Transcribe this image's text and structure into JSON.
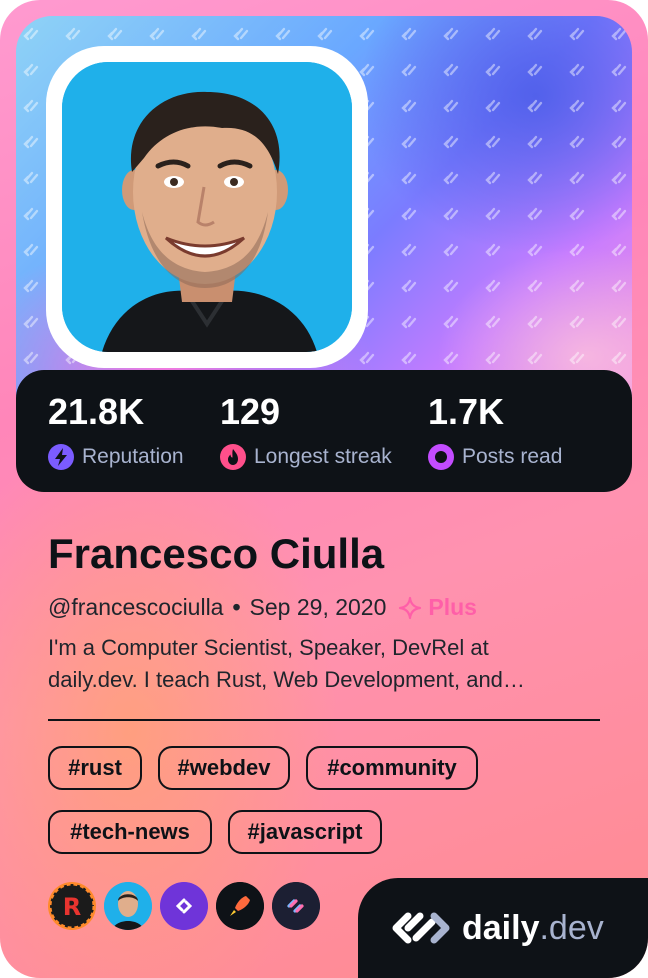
{
  "profile": {
    "name": "Francesco Ciulla",
    "username": "@francescociulla",
    "joined": "Sep 29, 2020",
    "plus_label": "Plus",
    "bio_line1": "I'm a Computer Scientist, Speaker, DevRel at",
    "bio_line2": "daily.dev. I teach Rust, Web Development, and…"
  },
  "stats": [
    {
      "value": "21.8K",
      "label": "Reputation",
      "icon": "lightning-icon",
      "color": "#7b5cff"
    },
    {
      "value": "129",
      "label": "Longest streak",
      "icon": "flame-icon",
      "color": "#ff4f8b"
    },
    {
      "value": "1.7K",
      "label": "Posts read",
      "icon": "eye-icon",
      "color": "#c34cff"
    }
  ],
  "tags": [
    "#rust",
    "#webdev",
    "#community",
    "#tech-news",
    "#javascript"
  ],
  "badges": [
    "rust-squad-icon",
    "francesco-squad-icon",
    "daily-dev-squad-icon",
    "rocket-squad-icon",
    "devs-squad-icon"
  ],
  "brand": {
    "name": "daily",
    "suffix": ".dev"
  },
  "colors": {
    "accent": "#ff5fa8",
    "dark": "#0e1217",
    "muted": "#a8b3cf"
  }
}
